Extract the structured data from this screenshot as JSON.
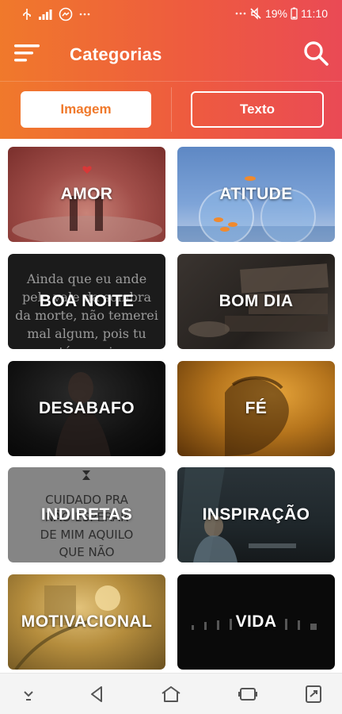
{
  "status_bar": {
    "battery": "19%",
    "time": "11:10",
    "icons": [
      "usb-icon",
      "signal-icon",
      "messenger-icon",
      "more-icon",
      "alarm-icon",
      "mute-icon",
      "battery-icon"
    ]
  },
  "toolbar": {
    "title": "Categorias",
    "menu_icon": "hamburger-menu-icon",
    "search_icon": "search-icon"
  },
  "tabs": [
    {
      "label": "Imagem",
      "selected": true
    },
    {
      "label": "Texto",
      "selected": false
    }
  ],
  "categories": [
    {
      "label": "AMOR"
    },
    {
      "label": "ATITUDE"
    },
    {
      "label": "BOA NOITE",
      "bg_text": [
        "Ainda que eu ande",
        "pelo vale da sombra",
        "da morte, não temerei",
        "mal algum, pois tu",
        "estás comigo"
      ]
    },
    {
      "label": "BOM DIA"
    },
    {
      "label": "DESABAFO"
    },
    {
      "label": "FÉ"
    },
    {
      "label": "INDIRETAS",
      "bg_text": [
        "CUIDADO PRA",
        "NÃO ESPERAR",
        "DE MIM AQUILO",
        "QUE NÃO"
      ]
    },
    {
      "label": "INSPIRAÇÃO"
    },
    {
      "label": "MOTIVACIONAL"
    },
    {
      "label": "VIDA"
    }
  ],
  "nav_bar": {
    "icons": [
      "hide-keyboard-icon",
      "back-icon",
      "home-icon",
      "recents-icon",
      "screenshot-icon"
    ]
  },
  "colors": {
    "header_start": "#f0792b",
    "header_end": "#ea4a55",
    "accent": "#f0792b"
  }
}
